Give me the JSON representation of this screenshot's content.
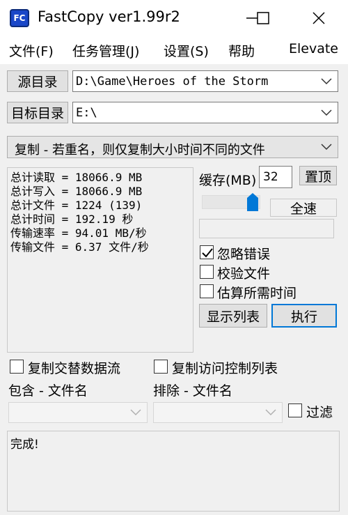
{
  "window": {
    "title": "FastCopy ver1.99r2",
    "icon_text": "FC"
  },
  "menu": [
    "文件(F)",
    "任务管理(J)",
    "设置(S)",
    "帮助",
    "Elevate"
  ],
  "source": {
    "button": "源目录",
    "path": "D:\\Game\\Heroes of the Storm"
  },
  "dest": {
    "button": "目标目录",
    "path": "E:\\"
  },
  "mode": {
    "selected": "复制 - 若重名，则仅复制大小时间不同的文件"
  },
  "stats": [
    "总计读取 = 18066.9 MB",
    "总计写入 = 18066.9 MB",
    "总计文件 = 1224 (139)",
    "总计时间 = 192.19 秒",
    "传输速率 = 94.01 MB/秒",
    "传输文件 = 6.37 文件/秒"
  ],
  "buffer": {
    "label": "缓存(MB)",
    "value": "32",
    "top_button": "置顶"
  },
  "speed": {
    "label": "全速",
    "slider_level": 1.0
  },
  "options": {
    "ignore_errors": {
      "label": "忽略错误",
      "checked": true
    },
    "verify": {
      "label": "校验文件",
      "checked": false
    },
    "estimate": {
      "label": "估算所需时间",
      "checked": false
    }
  },
  "actions": {
    "list": "显示列表",
    "execute": "执行"
  },
  "bottom": {
    "ads": {
      "label": "复制交替数据流",
      "checked": false
    },
    "acl": {
      "label": "复制访问控制列表",
      "checked": false
    },
    "include_label": "包含 - 文件名",
    "exclude_label": "排除 - 文件名",
    "filter": {
      "label": "过滤",
      "checked": false
    }
  },
  "log": {
    "text": "完成!"
  },
  "colors": {
    "accent_blue": "#0078d7",
    "exec_border": "#0078d7",
    "panel_bg": "#f0f0f0"
  }
}
